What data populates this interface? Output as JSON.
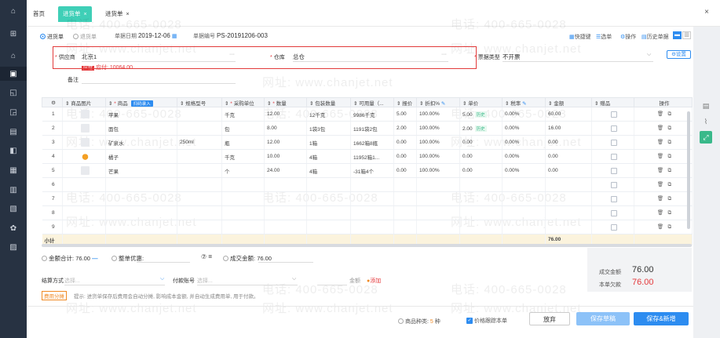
{
  "tabs": [
    {
      "label": "首页",
      "x": 8,
      "active": false
    },
    {
      "label": "进货单",
      "x": 42,
      "active": true
    },
    {
      "label": "进货单",
      "x": 96,
      "active": false
    }
  ],
  "header": {
    "type_purchase": "进货单",
    "type_return": "退货单",
    "date_label": "单据日期",
    "date_value": "2019-12-06",
    "no_label": "单据编号",
    "no_value": "PS-20191206-003",
    "shortcut": "快捷键",
    "select": "选单",
    "operate": "操作",
    "history": "历史单据"
  },
  "form": {
    "supplier_label": "供应商",
    "supplier_value": "北京1",
    "ellipsis": "···",
    "warehouse_label": "仓库",
    "warehouse_value": "总仓",
    "invoice_label": "票据类型",
    "invoice_value": "不开票",
    "settings": "设置",
    "payable_tag": "应付",
    "payable_value": "应付: 10064.00",
    "note_label": "备注"
  },
  "table": {
    "headers": [
      "",
      "商品图片",
      "商品",
      "规格型号",
      "采购单位",
      "数量",
      "包装数量",
      "可用量（...",
      "报价",
      "折扣%",
      "单价",
      "税率",
      "金额",
      "赠品",
      "操作"
    ],
    "batch_label": "扫码录入",
    "rows": [
      {
        "no": "1",
        "img": "gray",
        "name": "苹果",
        "spec": "",
        "unit": "千克",
        "qty": "12.00",
        "pack": "12千克",
        "avail": "9986千克",
        "quote": "5.00",
        "disc": "100.00%",
        "price": "5.00",
        "hist": "历史",
        "tax": "0.00%",
        "amount": "60.00"
      },
      {
        "no": "2",
        "img": "gray",
        "name": "面包",
        "spec": "",
        "unit": "包",
        "qty": "8.00",
        "pack": "1袋3包",
        "avail": "1191袋2包",
        "quote": "2.00",
        "disc": "100.00%",
        "price": "2.00",
        "hist": "历史",
        "tax": "0.00%",
        "amount": "16.00"
      },
      {
        "no": "3",
        "img": "gray",
        "name": "矿泉水",
        "spec": "250ml",
        "unit": "瓶",
        "qty": "12.00",
        "pack": "1箱",
        "avail": "1662箱8瓶",
        "quote": "0.00",
        "disc": "100.00%",
        "price": "0.00",
        "hist": "",
        "tax": "0.00%",
        "amount": "0.00"
      },
      {
        "no": "4",
        "img": "orange",
        "name": "橘子",
        "spec": "",
        "unit": "千克",
        "qty": "10.00",
        "pack": "4箱",
        "avail": "11952箱1...",
        "quote": "0.00",
        "disc": "100.00%",
        "price": "0.00",
        "hist": "",
        "tax": "0.00%",
        "amount": "0.00"
      },
      {
        "no": "5",
        "img": "gray",
        "name": "芒果",
        "spec": "",
        "unit": "个",
        "qty": "24.00",
        "pack": "4箱",
        "avail": "-31箱4个",
        "quote": "0.00",
        "disc": "100.00%",
        "price": "0.00",
        "hist": "",
        "tax": "0.00%",
        "amount": "0.00"
      },
      {
        "no": "6",
        "img": "",
        "name": "",
        "spec": "",
        "unit": "",
        "qty": "",
        "pack": "",
        "avail": "",
        "quote": "",
        "disc": "",
        "price": "",
        "hist": "",
        "tax": "",
        "amount": ""
      },
      {
        "no": "7",
        "img": "",
        "name": "",
        "spec": "",
        "unit": "",
        "qty": "",
        "pack": "",
        "avail": "",
        "quote": "",
        "disc": "",
        "price": "",
        "hist": "",
        "tax": "",
        "amount": ""
      },
      {
        "no": "8",
        "img": "",
        "name": "",
        "spec": "",
        "unit": "",
        "qty": "",
        "pack": "",
        "avail": "",
        "quote": "",
        "disc": "",
        "price": "",
        "hist": "",
        "tax": "",
        "amount": ""
      },
      {
        "no": "9",
        "img": "",
        "name": "",
        "spec": "",
        "unit": "",
        "qty": "",
        "pack": "",
        "avail": "",
        "quote": "",
        "disc": "",
        "price": "",
        "hist": "",
        "tax": "",
        "amount": ""
      }
    ],
    "subtotal_label": "小计",
    "subtotal_amount": "76.00"
  },
  "totals": {
    "amount_label": "金额合计:",
    "amount_value": "76.00",
    "discount_label": "整单优惠:",
    "deal_label": "成交金额:",
    "deal_value": "76.00",
    "settle_label": "结算方式",
    "settle_placeholder": "选择...",
    "account_label": "付款账号",
    "account_placeholder": "选择...",
    "money_label": "金额",
    "add_label": "添加",
    "fee_tag": "费用分摊",
    "tip": "提示: 进货单保存后费用会自动分摊, 影响成本金额, 并自动生成费用单, 用于付款。",
    "sum_deal_label": "成交金额",
    "sum_deal_value": "76.00",
    "sum_owe_label": "本单欠款",
    "sum_owe_value": "76.00"
  },
  "footer": {
    "kinds_label": "商品种类:",
    "kinds_value": "5",
    "kinds_unit": "种",
    "follow_label": "价格跟踪本单",
    "abandon": "放弃",
    "save_draft": "保存草稿",
    "save_new": "保存&新增"
  },
  "watermark": {
    "phone": "电话: 400-665-0028",
    "site": "网址: www.chanjet.net"
  },
  "colors": {
    "accent": "#2d8cf0",
    "tab": "#3fcfb7",
    "sidebar": "#273242",
    "danger": "#e4393c"
  }
}
